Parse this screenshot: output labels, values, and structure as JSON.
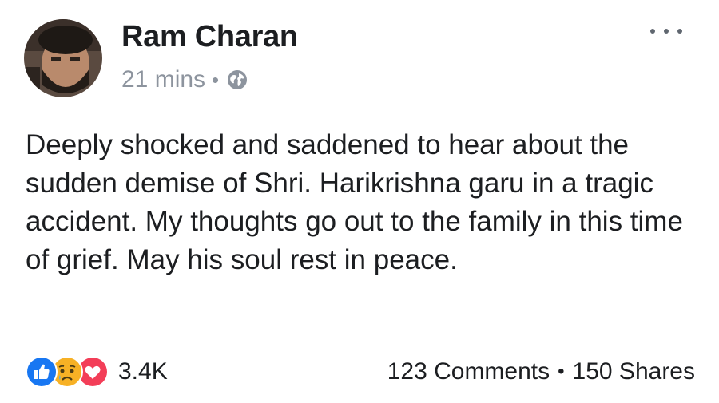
{
  "post": {
    "author_name": "Ram Charan",
    "timestamp": "21 mins",
    "meta_separator": "•",
    "privacy_icon": "globe-icon",
    "more_icon": "ellipsis-icon",
    "text": "Deeply shocked and saddened to hear about the sudden demise of Shri. Harikrishna garu in a tragic accident. My thoughts go out to the family in this time of grief. May his soul rest in peace."
  },
  "reactions": {
    "icons": [
      "like-icon",
      "sad-icon",
      "love-icon"
    ],
    "count": "3.4K"
  },
  "stats": {
    "comments": "123 Comments",
    "separator": "•",
    "shares": "150 Shares"
  },
  "colors": {
    "like": "#1877f2",
    "sad": "#f7b125",
    "love": "#f33e58",
    "meta": "#8d949e",
    "text": "#1c1e21"
  }
}
